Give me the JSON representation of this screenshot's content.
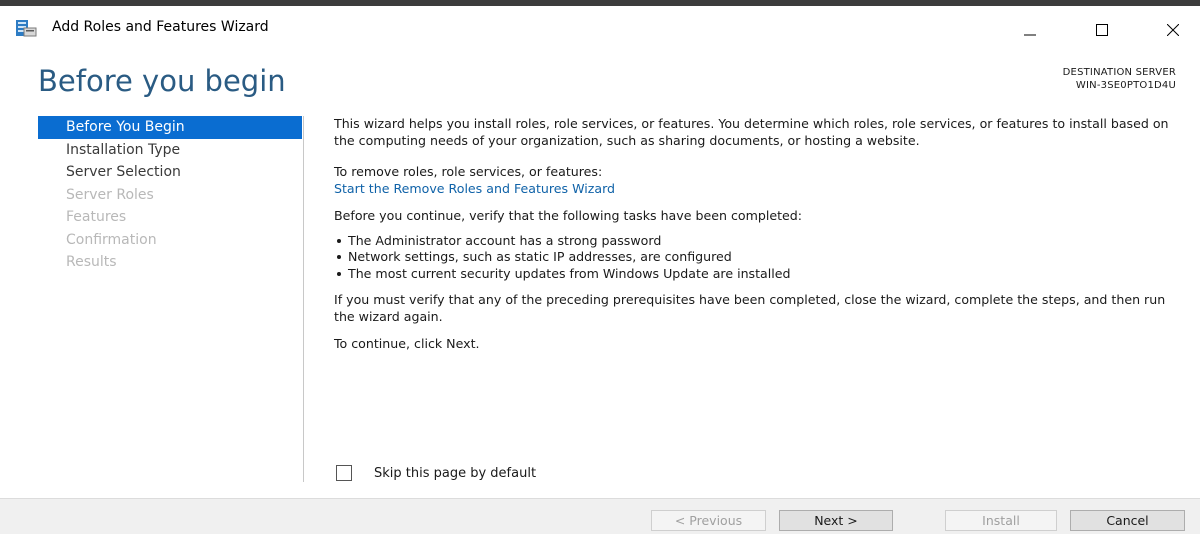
{
  "window": {
    "title": "Add Roles and Features Wizard"
  },
  "header": {
    "page_title": "Before you begin",
    "destination_label": "DESTINATION SERVER",
    "destination_value": "WIN-3SE0PTO1D4U"
  },
  "nav": {
    "items": [
      {
        "label": "Before You Begin",
        "state": "active"
      },
      {
        "label": "Installation Type",
        "state": "enabled"
      },
      {
        "label": "Server Selection",
        "state": "enabled"
      },
      {
        "label": "Server Roles",
        "state": "disabled"
      },
      {
        "label": "Features",
        "state": "disabled"
      },
      {
        "label": "Confirmation",
        "state": "disabled"
      },
      {
        "label": "Results",
        "state": "disabled"
      }
    ]
  },
  "content": {
    "intro": "This wizard helps you install roles, role services, or features. You determine which roles, role services, or features to install based on the computing needs of your organization, such as sharing documents, or hosting a website.",
    "remove_text": "To remove roles, role services, or features:",
    "remove_link": "Start the Remove Roles and Features Wizard",
    "verify_text": "Before you continue, verify that the following tasks have been completed:",
    "bullets": [
      "The Administrator account has a strong password",
      "Network settings, such as static IP addresses, are configured",
      "The most current security updates from Windows Update are installed"
    ],
    "must_verify": "If you must verify that any of the preceding prerequisites have been completed, close the wizard, complete the steps, and then run the wizard again.",
    "continue_text": "To continue, click Next."
  },
  "skip": {
    "label": "Skip this page by default",
    "checked": false
  },
  "footer": {
    "previous": "< Previous",
    "next": "Next >",
    "install": "Install",
    "cancel": "Cancel"
  },
  "colors": {
    "accent": "#0a6dd1",
    "title": "#2a5b83",
    "link": "#0f62a8"
  }
}
